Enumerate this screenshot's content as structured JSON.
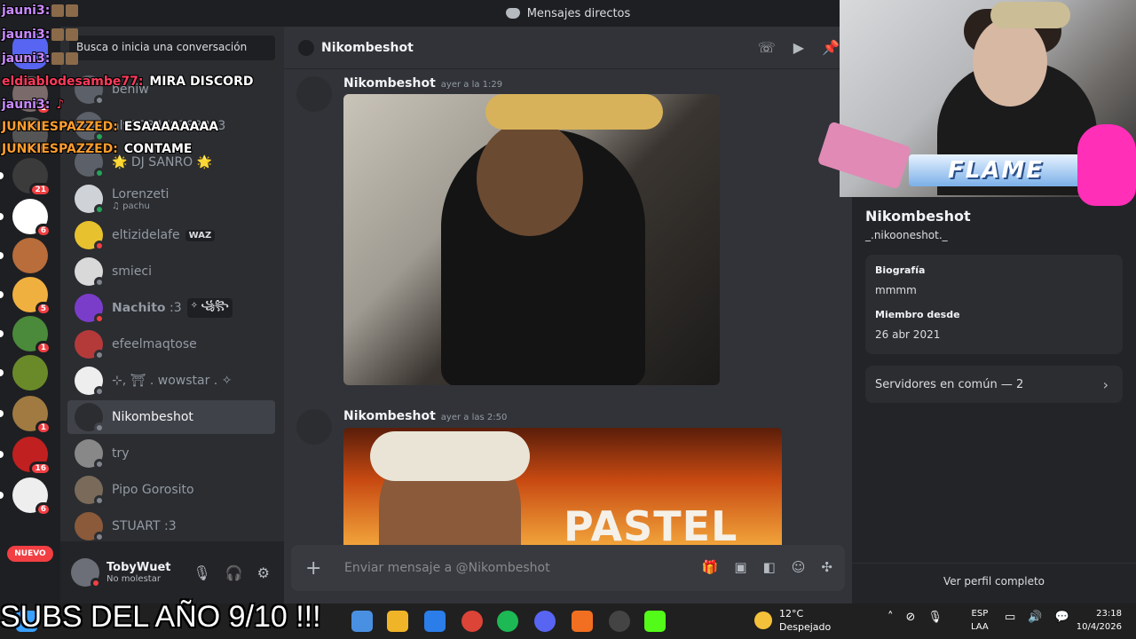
{
  "window": {
    "title": "Mensajes directos"
  },
  "servers": [
    {
      "badge": ""
    },
    {
      "badge": "1"
    },
    {
      "badge": "6"
    },
    {
      "badge": "21"
    },
    {
      "badge": "6"
    },
    {
      "badge": ""
    },
    {
      "badge": "5"
    },
    {
      "badge": "1"
    },
    {
      "badge": ""
    },
    {
      "badge": "1"
    },
    {
      "badge": "16"
    },
    {
      "badge": "6"
    }
  ],
  "servers_new_label": "NUEVO",
  "dm_search": {
    "placeholder": "Busca o inicia una conversación"
  },
  "dms": [
    {
      "name": "beniw",
      "sub": "",
      "status": "offline"
    },
    {
      "name": "al9323478383823",
      "sub": "",
      "status": "online"
    },
    {
      "name": "🌟 DJ SANRO 🌟",
      "sub": "",
      "status": "online"
    },
    {
      "name": "Lorenzeti",
      "sub": "♫ pachu",
      "status": "online"
    },
    {
      "name": "eltizidelafe",
      "sub": "",
      "tag": "WAZ",
      "status": "dnd"
    },
    {
      "name": "smieci",
      "sub": "",
      "status": "offline"
    },
    {
      "name": "𝗡𝗮𝗰𝗵𝗶𝘁𝗼 :3",
      "sub": "",
      "tag": "✧ ꧁꧂",
      "status": "dnd"
    },
    {
      "name": "efeelmaqtose",
      "sub": "",
      "status": "offline"
    },
    {
      "name": "⊹, ⛩ . wowstar . ✧",
      "sub": "",
      "status": "offline"
    },
    {
      "name": "Nikombeshot",
      "sub": "",
      "status": "offline",
      "active": true
    },
    {
      "name": "try",
      "sub": "",
      "status": "offline"
    },
    {
      "name": "Pipo Gorosito",
      "sub": "",
      "status": "offline"
    },
    {
      "name": "STUART :3",
      "sub": "",
      "status": "offline"
    }
  ],
  "user": {
    "name": "TobyWuet",
    "status": "No molestar"
  },
  "chat": {
    "channel": "Nikombeshot",
    "messages": [
      {
        "author": "Nikombeshot",
        "time": "ayer a la 1:29"
      },
      {
        "author": "Nikombeshot",
        "time": "ayer a las 2:50",
        "image_text": "PASTEL"
      }
    ],
    "composer_placeholder": "Enviar mensaje a @Nikombeshot"
  },
  "profile": {
    "name": "Nikombeshot",
    "handle": "_.nikooneshot._",
    "bio_label": "Biografía",
    "bio": "mmmm",
    "member_label": "Miembro desde",
    "member_since": "26 abr 2021",
    "servers_common": "Servidores en común — 2",
    "view_full": "Ver perfil completo"
  },
  "overlay": {
    "flame_text": "FLAME",
    "chat": [
      {
        "user": "jauni3:",
        "text": "",
        "color": "#c98bff"
      },
      {
        "user": "jauni3:",
        "text": "",
        "color": "#c98bff"
      },
      {
        "user": "jauni3:",
        "text": "",
        "color": "#c98bff"
      },
      {
        "user": "eldiablodesambe77:",
        "text": "MIRA DISCORD",
        "color": "#ff3b5c"
      },
      {
        "user": "jauni3:",
        "text": "♪",
        "color": "#c98bff"
      },
      {
        "user": "JUNKIESPAZZED:",
        "text": "ESAAAAAAAA",
        "color": "#ff9d2e"
      },
      {
        "user": "JUNKIESPAZZED:",
        "text": "CONTAME",
        "color": "#ff9d2e"
      }
    ],
    "banner": "SUBS DEL AÑO 9/10 !!!"
  },
  "taskbar": {
    "weather_temp": "12°C",
    "weather_desc": "Despejado",
    "lang1": "ESP",
    "lang2": "LAA",
    "time": "23:18",
    "date": "10/4/2026"
  },
  "colors": {
    "accent": "#5865f2",
    "dnd": "#f23f43",
    "online": "#23a55a"
  }
}
